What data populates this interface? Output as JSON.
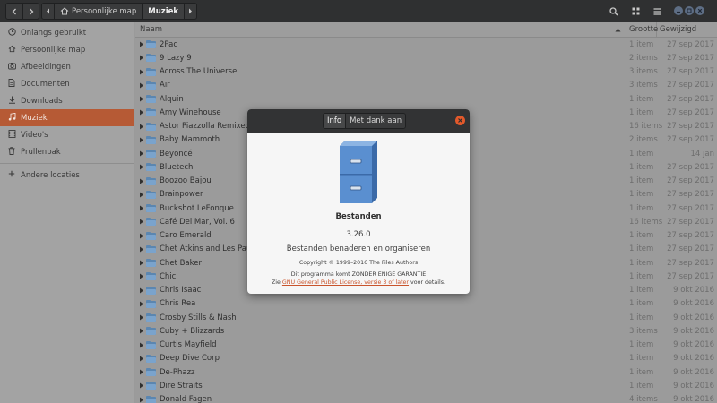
{
  "header": {
    "breadcrumbs": [
      {
        "label": "Persoonlijke map",
        "icon": "home-icon"
      },
      {
        "label": "Muziek",
        "active": true
      }
    ]
  },
  "sidebar": {
    "items": [
      {
        "label": "Onlangs gebruikt",
        "icon": "clock-icon"
      },
      {
        "label": "Persoonlijke map",
        "icon": "home-icon"
      },
      {
        "label": "Afbeeldingen",
        "icon": "camera-icon"
      },
      {
        "label": "Documenten",
        "icon": "document-icon"
      },
      {
        "label": "Downloads",
        "icon": "download-icon"
      },
      {
        "label": "Muziek",
        "icon": "music-icon",
        "active": true
      },
      {
        "label": "Video's",
        "icon": "video-icon"
      },
      {
        "label": "Prullenbak",
        "icon": "trash-icon"
      }
    ],
    "other": {
      "label": "Andere locaties",
      "icon": "plus-icon"
    }
  },
  "list": {
    "columns": {
      "name": "Naam",
      "size": "Grootte",
      "modified": "Gewijzigd"
    },
    "rows": [
      {
        "name": "2Pac",
        "size": "1 item",
        "modified": "27 sep 2017"
      },
      {
        "name": "9 Lazy 9",
        "size": "2 items",
        "modified": "27 sep 2017"
      },
      {
        "name": "Across The Universe",
        "size": "3 items",
        "modified": "27 sep 2017"
      },
      {
        "name": "Air",
        "size": "3 items",
        "modified": "27 sep 2017"
      },
      {
        "name": "Alquin",
        "size": "1 item",
        "modified": "27 sep 2017"
      },
      {
        "name": "Amy Winehouse",
        "size": "1 item",
        "modified": "27 sep 2017"
      },
      {
        "name": "Astor Piazzolla Remixed",
        "size": "16 items",
        "modified": "27 sep 2017"
      },
      {
        "name": "Baby Mammoth",
        "size": "2 items",
        "modified": "27 sep 2017"
      },
      {
        "name": "Beyoncé",
        "size": "1 item",
        "modified": "14 jan"
      },
      {
        "name": "Bluetech",
        "size": "1 item",
        "modified": "27 sep 2017"
      },
      {
        "name": "Boozoo Bajou",
        "size": "1 item",
        "modified": "27 sep 2017"
      },
      {
        "name": "Brainpower",
        "size": "1 item",
        "modified": "27 sep 2017"
      },
      {
        "name": "Buckshot LeFonque",
        "size": "1 item",
        "modified": "27 sep 2017"
      },
      {
        "name": "Café Del Mar, Vol. 6",
        "size": "16 items",
        "modified": "27 sep 2017"
      },
      {
        "name": "Caro Emerald",
        "size": "1 item",
        "modified": "27 sep 2017"
      },
      {
        "name": "Chet Atkins and Les Paul",
        "size": "1 item",
        "modified": "27 sep 2017"
      },
      {
        "name": "Chet Baker",
        "size": "1 item",
        "modified": "27 sep 2017"
      },
      {
        "name": "Chic",
        "size": "1 item",
        "modified": "27 sep 2017"
      },
      {
        "name": "Chris Isaac",
        "size": "1 item",
        "modified": "9 okt 2016"
      },
      {
        "name": "Chris Rea",
        "size": "1 item",
        "modified": "9 okt 2016"
      },
      {
        "name": "Crosby Stills & Nash",
        "size": "1 item",
        "modified": "9 okt 2016"
      },
      {
        "name": "Cuby + Blizzards",
        "size": "3 items",
        "modified": "9 okt 2016"
      },
      {
        "name": "Curtis Mayfield",
        "size": "1 item",
        "modified": "9 okt 2016"
      },
      {
        "name": "Deep Dive Corp",
        "size": "1 item",
        "modified": "9 okt 2016"
      },
      {
        "name": "De-Phazz",
        "size": "1 item",
        "modified": "9 okt 2016"
      },
      {
        "name": "Dire Straits",
        "size": "1 item",
        "modified": "9 okt 2016"
      },
      {
        "name": "Donald Fagen",
        "size": "4 items",
        "modified": "9 okt 2016"
      }
    ]
  },
  "about": {
    "tabs": {
      "info": "Info",
      "credits": "Met dank aan"
    },
    "icon": "file-cabinet-icon",
    "name": "Bestanden",
    "version": "3.26.0",
    "comment": "Bestanden benaderen en organiseren",
    "copyright": "Copyright © 1999–2016 The Files Authors",
    "license_line1": "Dit programma komt ZONDER ENIGE GARANTIE",
    "license_prefix": "Zie ",
    "license_link": "GNU General Public License, versie 3 of later",
    "license_suffix": " voor details."
  },
  "colors": {
    "accent": "#b65a35",
    "close": "#e2592b",
    "folder": "#7aa3cc"
  }
}
